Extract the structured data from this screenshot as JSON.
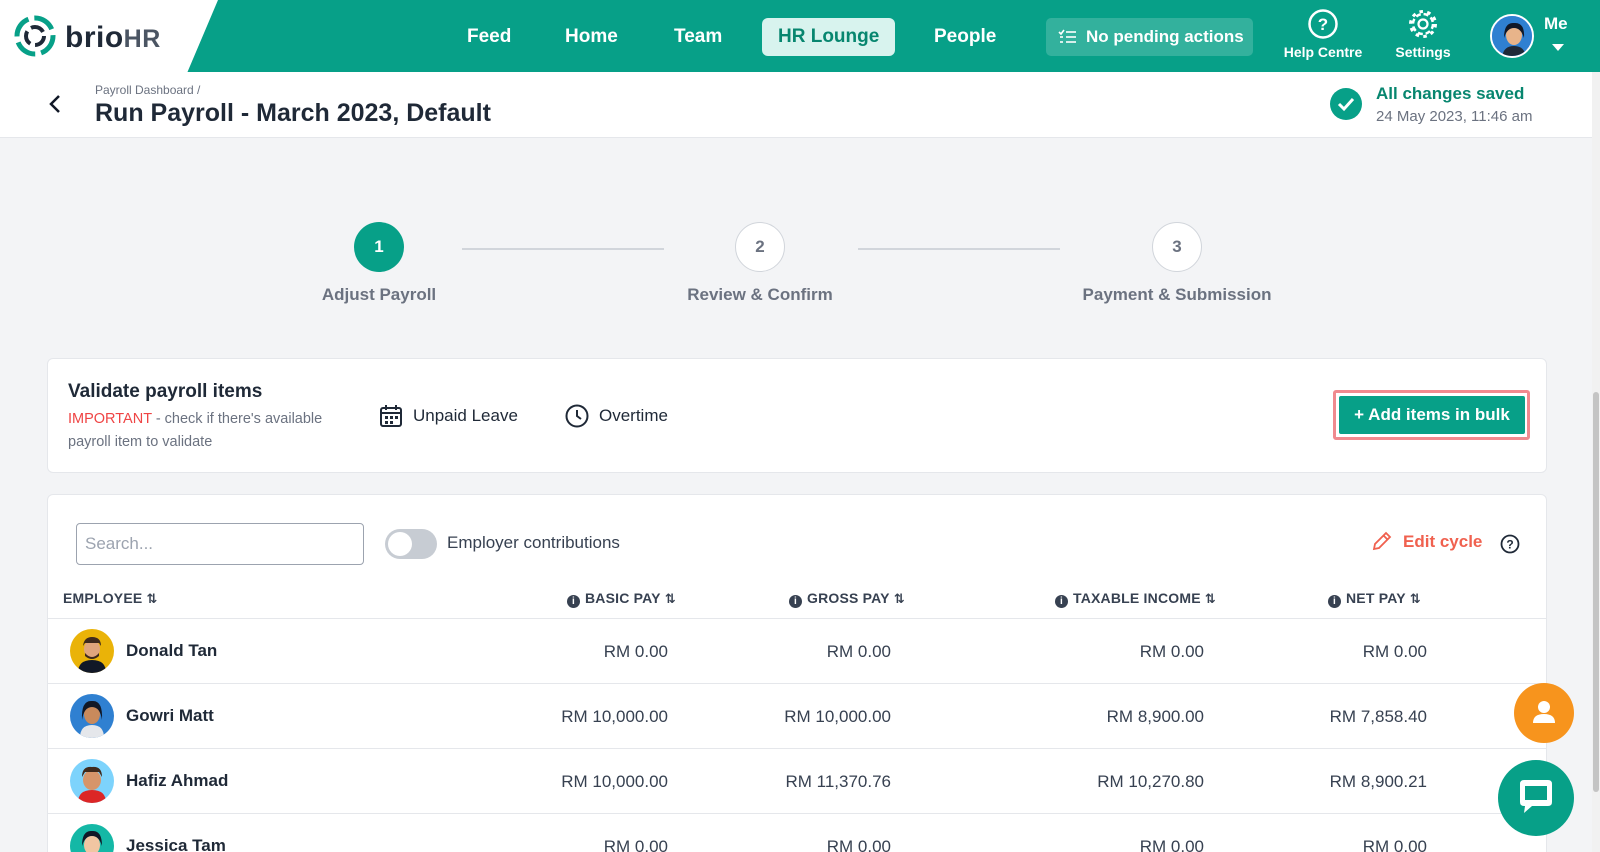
{
  "brand": {
    "logo_text": "brio",
    "logo_hr": "HR"
  },
  "nav": {
    "items": [
      {
        "label": "Feed"
      },
      {
        "label": "Home"
      },
      {
        "label": "Team"
      },
      {
        "label": "HR Lounge",
        "active": true
      },
      {
        "label": "People"
      }
    ],
    "pending_label": "No pending actions",
    "help_label": "Help Centre",
    "settings_label": "Settings",
    "me_label": "Me"
  },
  "header": {
    "breadcrumb": "Payroll Dashboard  /",
    "title": "Run Payroll - March 2023, Default",
    "saved_title": "All changes saved",
    "saved_time": "24 May 2023, 11:46 am"
  },
  "stepper": {
    "steps": [
      {
        "number": "1",
        "label": "Adjust Payroll",
        "state": "active"
      },
      {
        "number": "2",
        "label": "Review & Confirm",
        "state": "inactive"
      },
      {
        "number": "3",
        "label": "Payment & Submission",
        "state": "inactive"
      }
    ]
  },
  "validate": {
    "title": "Validate payroll items",
    "important": "IMPORTANT",
    "desc_rest": " - check if there's available payroll item to validate",
    "unpaid_leave": "Unpaid Leave",
    "overtime": "Overtime",
    "bulk_button": "+ Add items in bulk"
  },
  "table": {
    "search_placeholder": "Search...",
    "toggle_label": "Employer contributions",
    "edit_cycle": "Edit cycle",
    "columns": {
      "employee": "EMPLOYEE",
      "basic_pay": "BASIC PAY",
      "gross_pay": "GROSS PAY",
      "taxable_income": "TAXABLE INCOME",
      "net_pay": "NET PAY"
    },
    "rows": [
      {
        "name": "Donald Tan",
        "basic": "RM 0.00",
        "gross": "RM 0.00",
        "taxable": "RM 0.00",
        "net": "RM 0.00"
      },
      {
        "name": "Gowri Matt",
        "basic": "RM 10,000.00",
        "gross": "RM 10,000.00",
        "taxable": "RM 8,900.00",
        "net": "RM 7,858.40"
      },
      {
        "name": "Hafiz Ahmad",
        "basic": "RM 10,000.00",
        "gross": "RM 11,370.76",
        "taxable": "RM 10,270.80",
        "net": "RM 8,900.21"
      },
      {
        "name": "Jessica Tam",
        "basic": "RM 0.00",
        "gross": "RM 0.00",
        "taxable": "RM 0.00",
        "net": "RM 0.00"
      }
    ]
  },
  "colors": {
    "brand": "#07a088",
    "accent_orange": "#f7941d",
    "danger": "#ef4444",
    "edit": "#f0614f"
  }
}
